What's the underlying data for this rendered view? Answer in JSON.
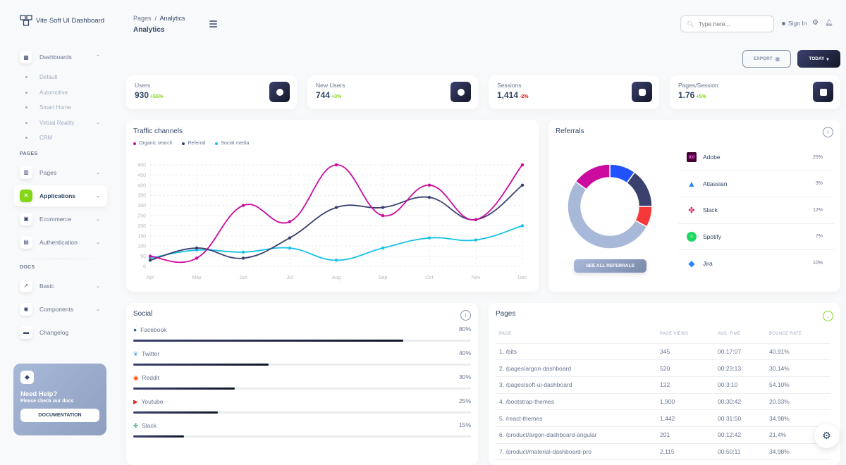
{
  "brand": {
    "name": "Vite Soft UI Dashboard"
  },
  "header": {
    "breadcrumb": [
      "Pages",
      "Analytics"
    ],
    "title": "Analytics",
    "search_placeholder": "Type here...",
    "signin_label": "Sign In",
    "export_label": "EXPORT",
    "today_label": "TODAY"
  },
  "sidebar": {
    "dashboards_label": "Dashboards",
    "dashboard_sub": [
      "Default",
      "Automotive",
      "Smart Home",
      "Virtual Reality",
      "CRM"
    ],
    "pages_section": "PAGES",
    "pages_items": [
      "Pages",
      "Applications",
      "Ecommerce",
      "Authentication"
    ],
    "docs_section": "DOCS",
    "docs_items": [
      "Basic",
      "Components",
      "Changelog"
    ],
    "help": {
      "title": "Need Help?",
      "subtitle": "Please check our docs",
      "button": "DOCUMENTATION"
    }
  },
  "stats": [
    {
      "label": "Users",
      "value": "930",
      "change": "+55%",
      "color": "#82d616"
    },
    {
      "label": "New Users",
      "value": "744",
      "change": "+3%",
      "color": "#82d616"
    },
    {
      "label": "Sessions",
      "value": "1,414",
      "change": "-2%",
      "color": "#ea0606"
    },
    {
      "label": "Pages/Session",
      "value": "1.76",
      "change": "+5%",
      "color": "#82d616"
    }
  ],
  "traffic": {
    "title": "Traffic channels"
  },
  "chart_data": {
    "type": "line",
    "title": "Traffic channels",
    "categories": [
      "Apr",
      "May",
      "Jun",
      "Jul",
      "Aug",
      "Sep",
      "Oct",
      "Nov",
      "Dec"
    ],
    "series": [
      {
        "name": "Organic search",
        "color": "#cb0c9f",
        "values": [
          50,
          40,
          300,
          220,
          500,
          250,
          400,
          230,
          500
        ]
      },
      {
        "name": "Referral",
        "color": "#3a416f",
        "values": [
          30,
          90,
          40,
          140,
          290,
          290,
          340,
          230,
          400
        ]
      },
      {
        "name": "Social media",
        "color": "#17c1e8",
        "values": [
          40,
          80,
          70,
          90,
          30,
          90,
          140,
          130,
          200
        ]
      }
    ],
    "yticks": [
      0,
      50,
      100,
      150,
      200,
      250,
      300,
      350,
      400,
      450,
      500
    ],
    "ylim": [
      0,
      500
    ],
    "grid": true,
    "legend": "top-left"
  },
  "referrals": {
    "title": "Referrals",
    "button": "SEE ALL REFERRALS",
    "items": [
      {
        "name": "Adobe",
        "pct": "25%"
      },
      {
        "name": "Atlassian",
        "pct": "3%"
      },
      {
        "name": "Slack",
        "pct": "12%"
      },
      {
        "name": "Spotify",
        "pct": "7%"
      },
      {
        "name": "Jira",
        "pct": "10%"
      }
    ],
    "donut": [
      {
        "name": "segment-blue",
        "value": 10,
        "color": "#2152ff"
      },
      {
        "name": "segment-navy",
        "value": 15,
        "color": "#3a416f"
      },
      {
        "name": "segment-red",
        "value": 8,
        "color": "#f53939"
      },
      {
        "name": "segment-slate",
        "value": 52,
        "color": "#a8b8d8"
      },
      {
        "name": "segment-magenta",
        "value": 15,
        "color": "#cb0c9f"
      }
    ]
  },
  "social": {
    "title": "Social",
    "items": [
      {
        "name": "Facebook",
        "pct": "80%",
        "value": 80
      },
      {
        "name": "Twitter",
        "pct": "40%",
        "value": 40
      },
      {
        "name": "Reddit",
        "pct": "30%",
        "value": 30
      },
      {
        "name": "Youtube",
        "pct": "25%",
        "value": 25
      },
      {
        "name": "Slack",
        "pct": "15%",
        "value": 15
      }
    ]
  },
  "pages": {
    "title": "Pages",
    "columns": [
      "PAGE",
      "PAGE VIEWS",
      "AVG. TIME",
      "BOUNCE RATE"
    ],
    "rows": [
      [
        "1. /bits",
        "345",
        "00:17:07",
        "40.91%"
      ],
      [
        "2. /pages/argon-dashboard",
        "520",
        "00:23:13",
        "30.14%"
      ],
      [
        "3. /pages/soft-ui-dashboard",
        "122",
        "00:3:10",
        "54.10%"
      ],
      [
        "4. /bootstrap-themes",
        "1,900",
        "00:30:42",
        "20.93%"
      ],
      [
        "5. /react-themes",
        "1,442",
        "00:31:50",
        "34.98%"
      ],
      [
        "6. /product/argon-dashboard-angular",
        "201",
        "00:12:42",
        "21.4%"
      ],
      [
        "7. /product/material-dashboard-pro",
        "2,115",
        "00:50:11",
        "34.98%"
      ]
    ]
  }
}
